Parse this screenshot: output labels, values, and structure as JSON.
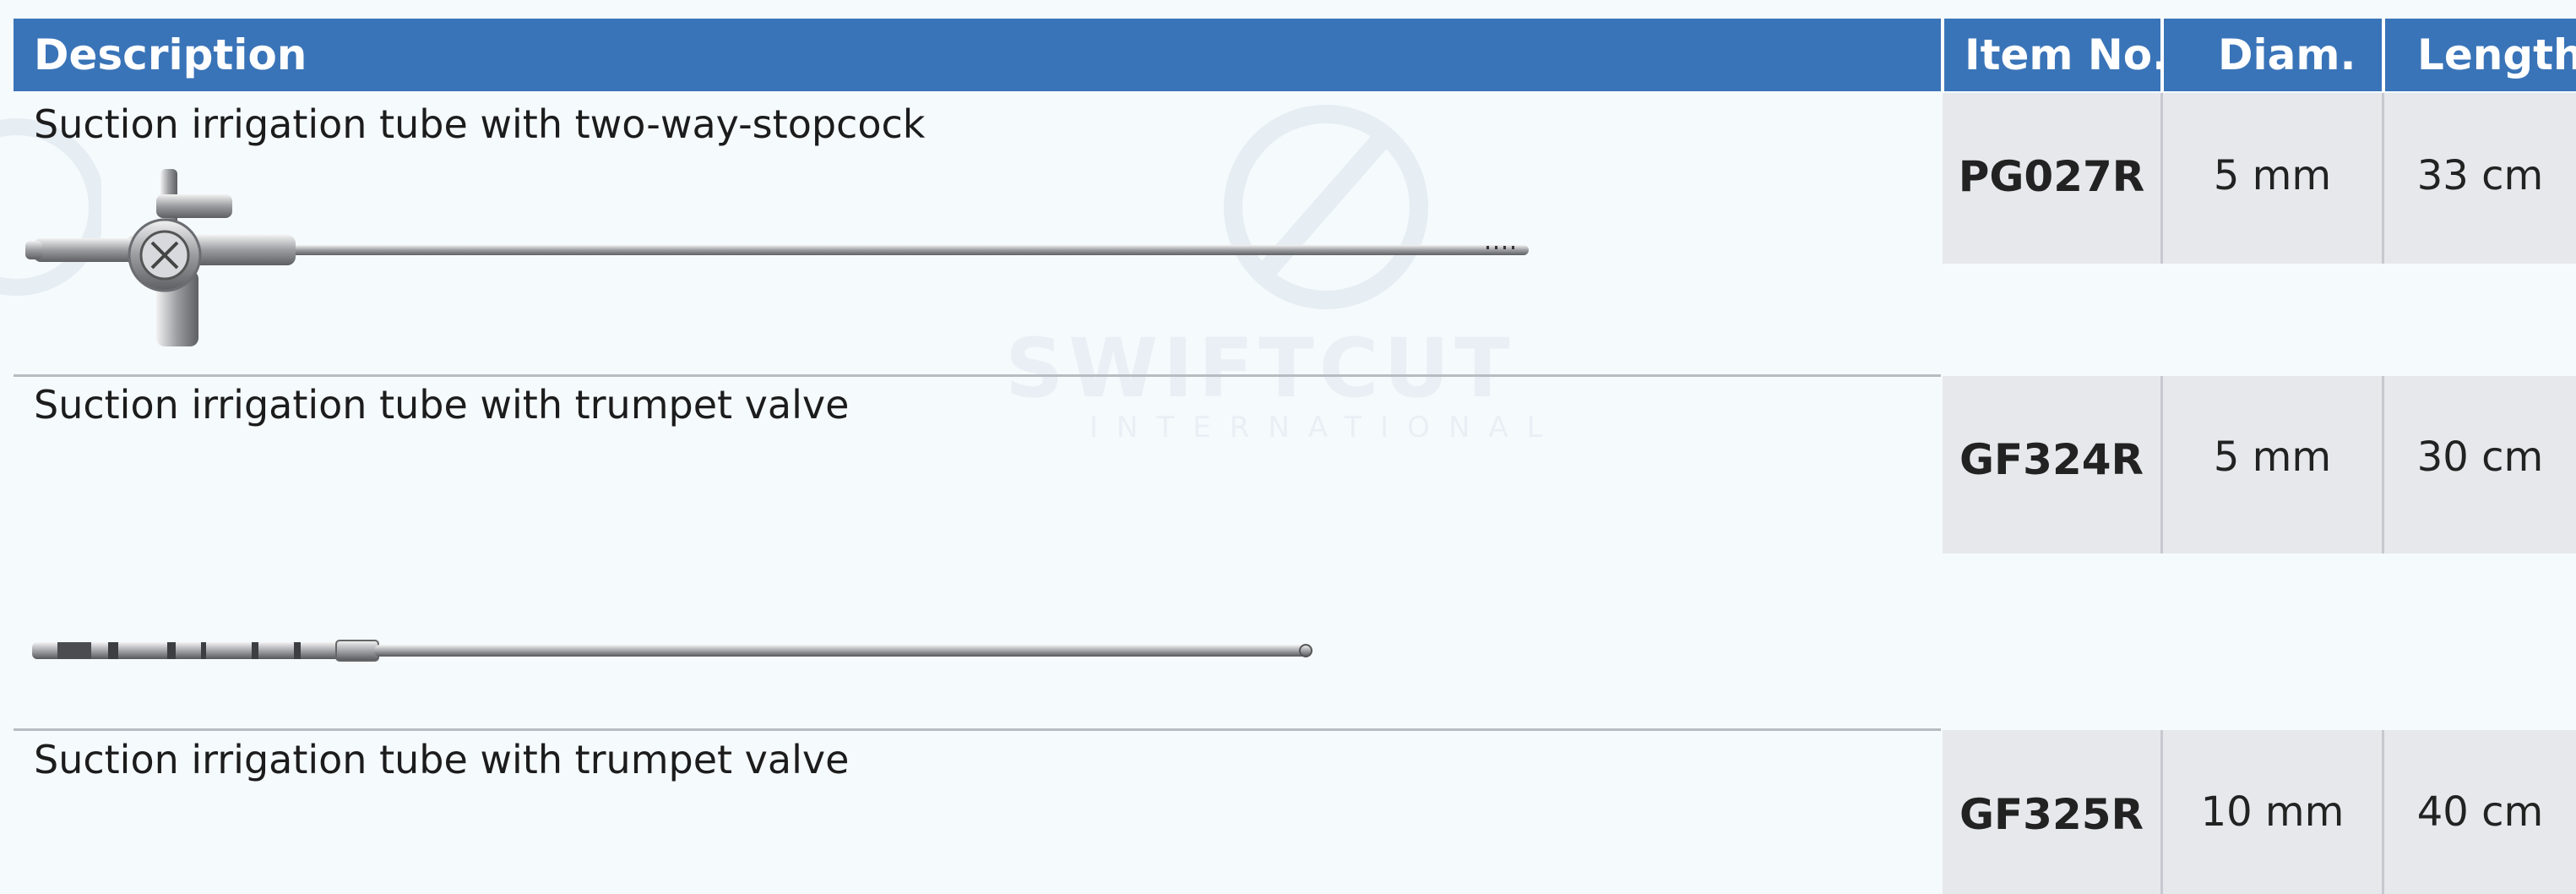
{
  "table": {
    "headers": {
      "description": "Description",
      "item_no": "Item No.",
      "diam": "Diam.",
      "length": "Length"
    },
    "rows": [
      {
        "description": "Suction irrigation tube with two-way-stopcock",
        "item_no": "PG027R",
        "diam": "5 mm",
        "length": "33 cm"
      },
      {
        "description": "Suction irrigation tube with trumpet valve",
        "item_no": "GF324R",
        "diam": "5 mm",
        "length": "30 cm"
      },
      {
        "description": "Suction irrigation tube with trumpet valve",
        "item_no": "GF325R",
        "diam": "10 mm",
        "length": "40 cm"
      }
    ]
  },
  "watermark": {
    "brand": "SWIFTCUT",
    "sub": "INTERNATIONAL"
  },
  "colors": {
    "header": "#3a74b8",
    "cell": "#e6e8ec",
    "background": "#f5fafd"
  }
}
